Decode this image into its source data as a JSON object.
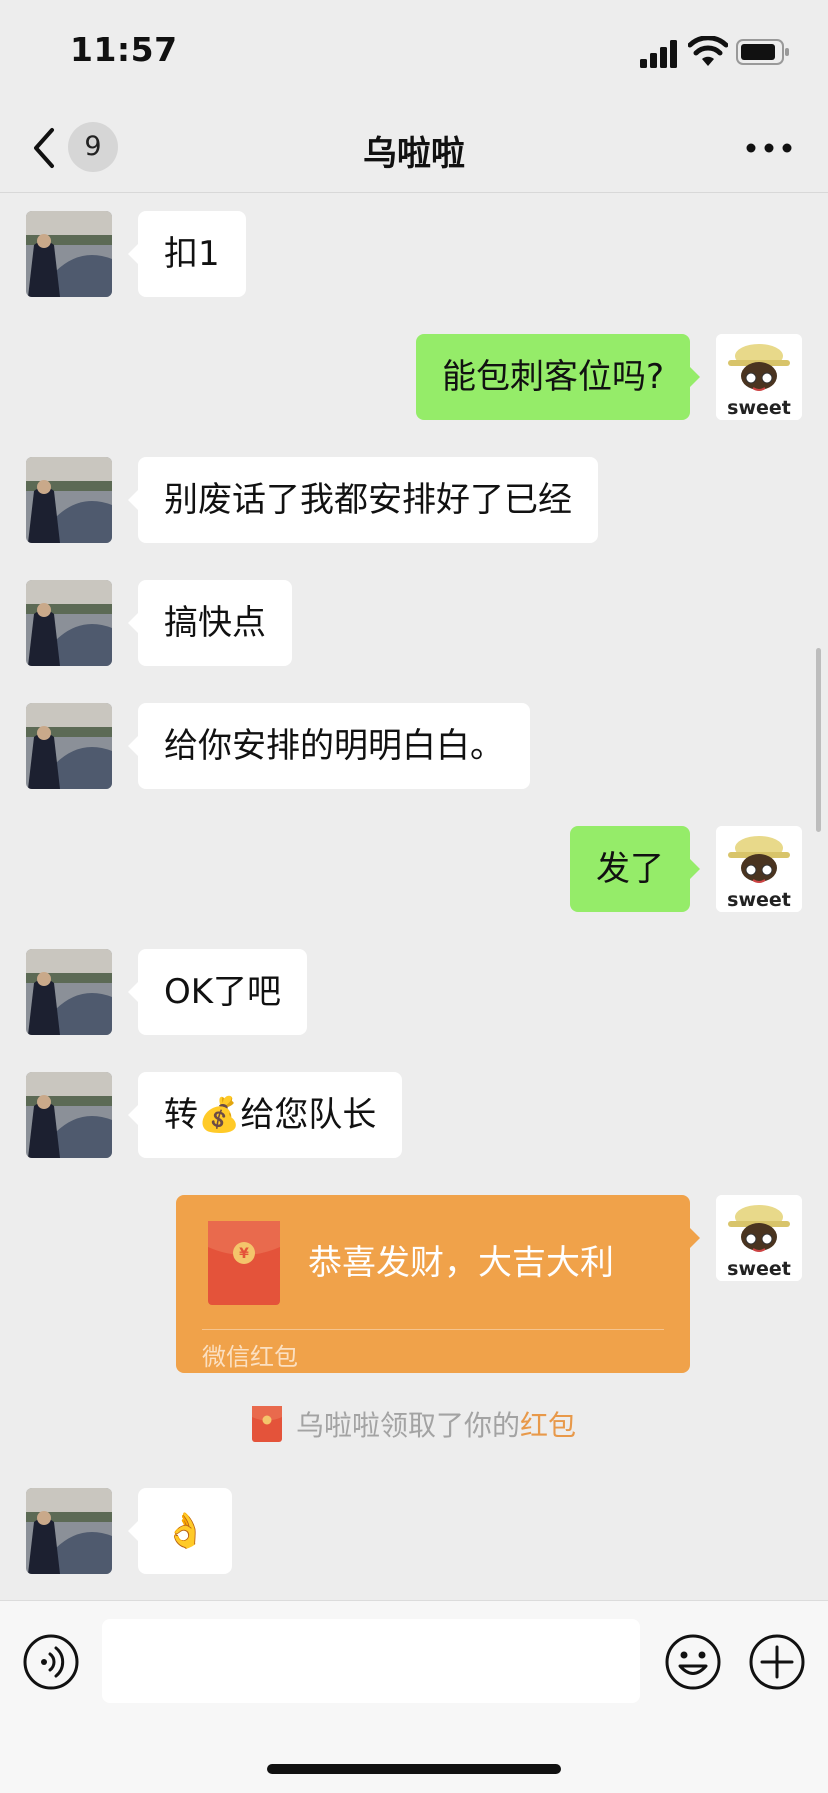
{
  "status_bar": {
    "time": "11:57"
  },
  "nav": {
    "unread_count": "9",
    "title": "乌啦啦"
  },
  "messages": [
    {
      "text": "扣1"
    },
    {
      "text": "能包刺客位吗?"
    },
    {
      "text": "别废话了我都安排好了已经"
    },
    {
      "text": "搞快点"
    },
    {
      "text": "给你安排的明明白白。"
    },
    {
      "text": "发了"
    },
    {
      "text": "OK了吧"
    },
    {
      "text": "转💰给您队长"
    },
    {
      "redpacket": {
        "greeting": "恭喜发财，大吉大利",
        "label": "微信红包",
        "symbol": "¥"
      }
    },
    {
      "notice": {
        "prefix": "乌啦啦领取了你的",
        "link": "红包"
      }
    },
    {
      "text": "👌"
    }
  ],
  "avatars": {
    "self_label": "sweet"
  },
  "input": {
    "placeholder": ""
  },
  "colors": {
    "accent_green": "#95ec69",
    "redpacket": "#f0a24a",
    "notice_link": "#e8994a",
    "background": "#ededed"
  }
}
